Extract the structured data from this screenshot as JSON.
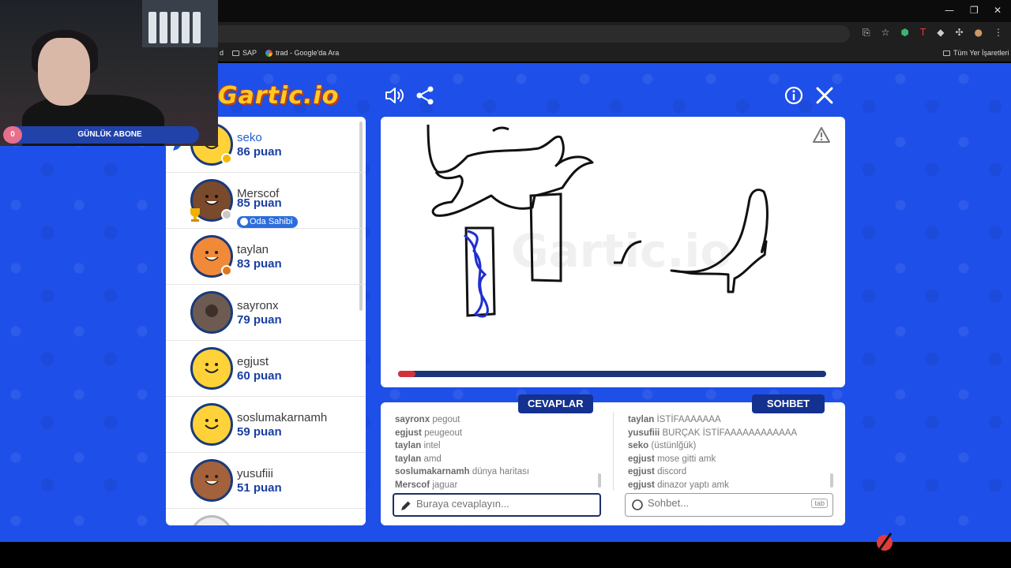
{
  "browser": {
    "bookmarks": [
      {
        "label": "d",
        "icon": "folder-icon"
      },
      {
        "label": "SAP",
        "icon": "folder-icon"
      },
      {
        "label": "trad - Google'da Ara",
        "icon": "google-icon"
      },
      {
        "label": "Tüm Yer İşaretleri",
        "icon": "folder-icon"
      }
    ],
    "window_controls": [
      "—",
      "❐",
      "✕"
    ]
  },
  "overlay": {
    "sub_count": "0",
    "sub_label": "GÜNLÜK ABONE"
  },
  "header": {
    "logo": "Gartic.io",
    "sound_icon": "speaker-icon",
    "share_icon": "share-icon",
    "info_icon": "info-icon",
    "close_icon": "close-icon"
  },
  "players": [
    {
      "name": "seko",
      "score": "86 puan",
      "status": "#f5b800",
      "drawing": true
    },
    {
      "name": "Merscof",
      "score": "85 puan",
      "status": "#c9c9c9",
      "badge": "Oda Sahibi",
      "rank": "1"
    },
    {
      "name": "taylan",
      "score": "83 puan",
      "status": "#e0761c"
    },
    {
      "name": "sayronx",
      "score": "79 puan"
    },
    {
      "name": "egjust",
      "score": "60 puan"
    },
    {
      "name": "soslumakarnamh",
      "score": "59 puan"
    },
    {
      "name": "yusufiii",
      "score": "51 puan"
    }
  ],
  "canvas": {
    "progress": 0.04,
    "warning_icon": "warning-icon"
  },
  "answers": {
    "title": "CEVAPLAR",
    "messages": [
      {
        "user": "sayronx",
        "text": "pegout"
      },
      {
        "user": "egjust",
        "text": "peugeout"
      },
      {
        "user": "taylan",
        "text": "intel"
      },
      {
        "user": "taylan",
        "text": "amd"
      },
      {
        "user": "soslumakarnamh",
        "text": "dünya haritası"
      },
      {
        "user": "Merscof",
        "text": "jaguar"
      }
    ],
    "placeholder": "Buraya cevaplayın..."
  },
  "chat": {
    "title": "SOHBET",
    "messages": [
      {
        "user": "taylan",
        "text": "İSTİFAAAAAAA"
      },
      {
        "user": "yusufiii",
        "text": "BURÇAK İSTİFAAAAAAAAAAAA"
      },
      {
        "user": "seko",
        "text": "(üstünlğük)"
      },
      {
        "user": "egjust",
        "text": "mose gitti amk"
      },
      {
        "user": "egjust",
        "text": "discord"
      },
      {
        "user": "egjust",
        "text": "dinazor yaptı amk"
      }
    ],
    "placeholder": "Sohbet...",
    "tab_hint": "tab"
  },
  "colors": {
    "background": "#1e4fe8",
    "navy": "#14318f",
    "timer": "#d2323a"
  }
}
